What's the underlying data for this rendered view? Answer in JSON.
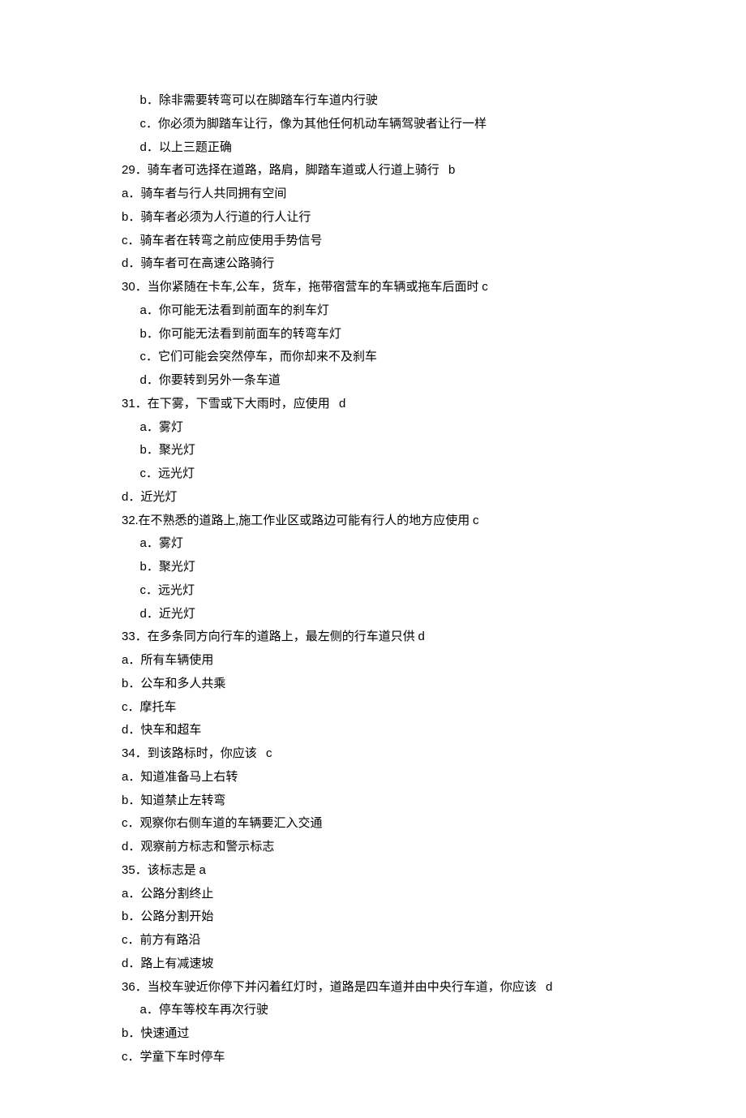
{
  "lines": [
    {
      "indent": 1,
      "label": "b",
      "text": "除非需要转弯可以在脚踏车行车道内行驶"
    },
    {
      "indent": 1,
      "label": "c",
      "text": "你必须为脚踏车让行，像为其他任何机动车辆驾驶者让行一样"
    },
    {
      "indent": 1,
      "label": "d",
      "text": "以上三题正确"
    },
    {
      "indent": 0,
      "qnum": "29",
      "qtext": "．骑车者可选择在道路，路肩，脚踏车道或人行道上骑行   ",
      "ans": "b"
    },
    {
      "indent": 0,
      "label": "a",
      "text": "骑车者与行人共同拥有空间"
    },
    {
      "indent": 0,
      "label": "b",
      "text": "骑车者必须为人行道的行人让行"
    },
    {
      "indent": 0,
      "label": "c",
      "text": "骑车者在转弯之前应使用手势信号"
    },
    {
      "indent": 0,
      "label": "d",
      "text": "骑车者可在高速公路骑行"
    },
    {
      "indent": 0,
      "qnum": "30",
      "qtext": "．当你紧随在卡车,公车，货车，拖带宿营车的车辆或拖车后面时 ",
      "ans": "c"
    },
    {
      "indent": 1,
      "label": "a",
      "text": "你可能无法看到前面车的刹车灯"
    },
    {
      "indent": 1,
      "label": "b",
      "text": "你可能无法看到前面车的转弯车灯"
    },
    {
      "indent": 1,
      "label": "c",
      "text": "它们可能会突然停车，而你却来不及刹车"
    },
    {
      "indent": 1,
      "label": "d",
      "text": "你要转到另外一条车道"
    },
    {
      "indent": 0,
      "qnum": "31",
      "qtext": "．在下雾，下雪或下大雨时，应使用   ",
      "ans": "d"
    },
    {
      "indent": 1,
      "label": "a",
      "text": "雾灯"
    },
    {
      "indent": 1,
      "label": "b",
      "text": "聚光灯"
    },
    {
      "indent": 1,
      "label": "c",
      "text": "远光灯"
    },
    {
      "indent": 0,
      "label": "d",
      "text": "近光灯"
    },
    {
      "indent": 0,
      "qnum": "32",
      "qtext": ".在不熟悉的道路上,施工作业区或路边可能有行人的地方应使用 ",
      "ans": "c"
    },
    {
      "indent": 1,
      "label": "a",
      "text": "雾灯"
    },
    {
      "indent": 1,
      "label": "b",
      "text": "聚光灯"
    },
    {
      "indent": 1,
      "label": "c",
      "text": "远光灯"
    },
    {
      "indent": 1,
      "label": "d",
      "text": "近光灯"
    },
    {
      "indent": 0,
      "qnum": "33",
      "qtext": "．在多条同方向行车的道路上，最左侧的行车道只供 ",
      "ans": "d"
    },
    {
      "indent": 0,
      "label": "a",
      "text": "所有车辆使用"
    },
    {
      "indent": 0,
      "label": "b",
      "text": "公车和多人共乘"
    },
    {
      "indent": 0,
      "label": "c",
      "text": "摩托车"
    },
    {
      "indent": 0,
      "label": "d",
      "text": "快车和超车"
    },
    {
      "indent": 0,
      "qnum": "34",
      "qtext": "．到该路标时，你应该   ",
      "ans": "c"
    },
    {
      "indent": 0,
      "label": "a",
      "text": "知道准备马上右转"
    },
    {
      "indent": 0,
      "label": "b",
      "text": "知道禁止左转弯"
    },
    {
      "indent": 0,
      "label": "c",
      "text": "观察你右侧车道的车辆要汇入交通"
    },
    {
      "indent": 0,
      "label": "d",
      "text": "观察前方标志和警示标志"
    },
    {
      "indent": 0,
      "qnum": "35",
      "qtext": "．该标志是 ",
      "ans": "a"
    },
    {
      "indent": 0,
      "label": "a",
      "text": "公路分割终止"
    },
    {
      "indent": 0,
      "label": "b",
      "text": "公路分割开始"
    },
    {
      "indent": 0,
      "label": "c",
      "text": "前方有路沿"
    },
    {
      "indent": 0,
      "label": "d",
      "text": "路上有减速坡"
    },
    {
      "indent": 0,
      "qnum": "36",
      "qtext": "．当校车驶近你停下并闪着红灯时，道路是四车道并由中央行车道，你应该   ",
      "ans": "d"
    },
    {
      "indent": 1,
      "label": "a",
      "text": "停车等校车再次行驶"
    },
    {
      "indent": 0,
      "label": "b",
      "text": "快速通过"
    },
    {
      "indent": 0,
      "label": "c",
      "text": "学童下车时停车"
    }
  ]
}
